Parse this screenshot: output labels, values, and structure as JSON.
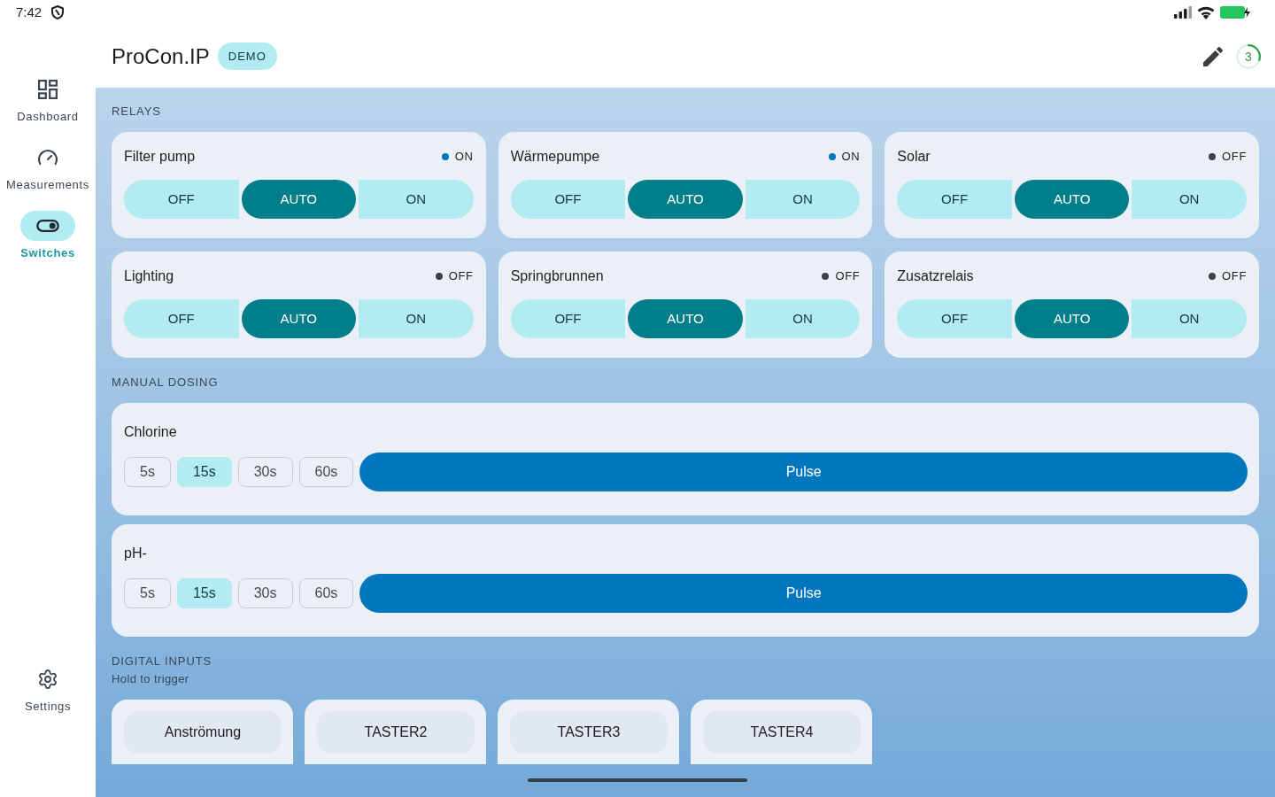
{
  "status_bar": {
    "time": "7:42"
  },
  "sidebar": {
    "items": [
      {
        "kind": "dashboard",
        "label": "Dashboard",
        "selected": false
      },
      {
        "kind": "gauge",
        "label": "Measurements",
        "selected": false
      },
      {
        "kind": "toggle",
        "label": "Switches",
        "selected": true
      }
    ],
    "footer_item": {
      "kind": "settings",
      "label": "Settings",
      "selected": false
    }
  },
  "header": {
    "title": "ProCon.IP",
    "badge": "DEMO",
    "countdown": {
      "value": "3"
    }
  },
  "relays": {
    "heading": "RELAYS",
    "items": [
      {
        "name": "Filter pump",
        "status": "ON",
        "active": true,
        "modes": [
          {
            "label": "OFF",
            "selected": false
          },
          {
            "label": "AUTO",
            "selected": true
          },
          {
            "label": "ON",
            "selected": false
          }
        ]
      },
      {
        "name": "Wärmepumpe",
        "status": "ON",
        "active": true,
        "modes": [
          {
            "label": "OFF",
            "selected": false
          },
          {
            "label": "AUTO",
            "selected": true
          },
          {
            "label": "ON",
            "selected": false
          }
        ]
      },
      {
        "name": "Solar",
        "status": "OFF",
        "active": false,
        "modes": [
          {
            "label": "OFF",
            "selected": false
          },
          {
            "label": "AUTO",
            "selected": true
          },
          {
            "label": "ON",
            "selected": false
          }
        ]
      },
      {
        "name": "Lighting",
        "status": "OFF",
        "active": false,
        "modes": [
          {
            "label": "OFF",
            "selected": false
          },
          {
            "label": "AUTO",
            "selected": true
          },
          {
            "label": "ON",
            "selected": false
          }
        ]
      },
      {
        "name": "Springbrunnen",
        "status": "OFF",
        "active": false,
        "modes": [
          {
            "label": "OFF",
            "selected": false
          },
          {
            "label": "AUTO",
            "selected": true
          },
          {
            "label": "ON",
            "selected": false
          }
        ]
      },
      {
        "name": "Zusatzrelais",
        "status": "OFF",
        "active": false,
        "modes": [
          {
            "label": "OFF",
            "selected": false
          },
          {
            "label": "AUTO",
            "selected": true
          },
          {
            "label": "ON",
            "selected": false
          }
        ]
      }
    ]
  },
  "manual_dosing": {
    "heading": "MANUAL DOSING",
    "items": [
      {
        "name": "Chlorine",
        "durations": [
          {
            "label": "5s",
            "selected": false
          },
          {
            "label": "15s",
            "selected": true
          },
          {
            "label": "30s",
            "selected": false
          },
          {
            "label": "60s",
            "selected": false
          }
        ],
        "action": "Pulse"
      },
      {
        "name": "pH-",
        "durations": [
          {
            "label": "5s",
            "selected": false
          },
          {
            "label": "15s",
            "selected": true
          },
          {
            "label": "30s",
            "selected": false
          },
          {
            "label": "60s",
            "selected": false
          }
        ],
        "action": "Pulse"
      }
    ]
  },
  "digital_inputs": {
    "heading": "DIGITAL INPUTS",
    "subtitle": "Hold to trigger",
    "items": [
      {
        "label": "Anströmung"
      },
      {
        "label": "TASTER2"
      },
      {
        "label": "TASTER3"
      },
      {
        "label": "TASTER4"
      }
    ]
  }
}
